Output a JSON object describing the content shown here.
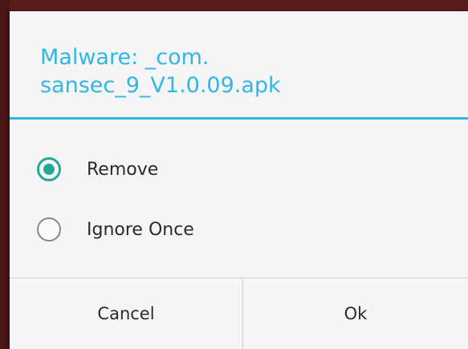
{
  "dialog": {
    "title": "Malware: _com.\nsansec_9_V1.0.09.apk",
    "accent_color": "#33b5e5",
    "options": [
      {
        "label": "Remove",
        "selected": true
      },
      {
        "label": "Ignore Once",
        "selected": false
      }
    ],
    "buttons": {
      "cancel_label": "Cancel",
      "ok_label": "Ok"
    }
  }
}
